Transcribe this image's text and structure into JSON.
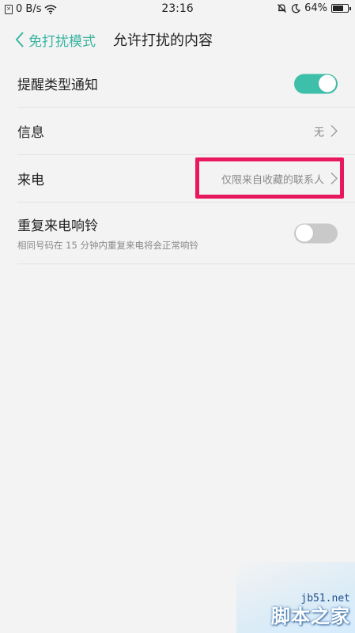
{
  "status_bar": {
    "net_speed": "0 B/s",
    "time": "23:16",
    "battery": "64%",
    "battery_level": 0.64,
    "icons": [
      "sim-icon",
      "wifi-icon",
      "mute-bell-icon",
      "moon-icon",
      "battery-icon"
    ]
  },
  "header": {
    "back_label": "免打扰模式",
    "title": "允许打扰的内容"
  },
  "rows": [
    {
      "label": "提醒类型通知",
      "toggle": true
    },
    {
      "label": "信息",
      "value": "无"
    },
    {
      "label": "来电",
      "value": "仅限来自收藏的联系人"
    },
    {
      "label": "重复来电响铃",
      "sublabel": "相同号码在 15 分钟内重复来电将会正常响铃",
      "toggle": false
    }
  ],
  "colors": {
    "accent": "#3ab5a1",
    "highlight_box": "#e8185f"
  },
  "watermark": {
    "site": "jb51.net",
    "name": "脚本之家"
  }
}
